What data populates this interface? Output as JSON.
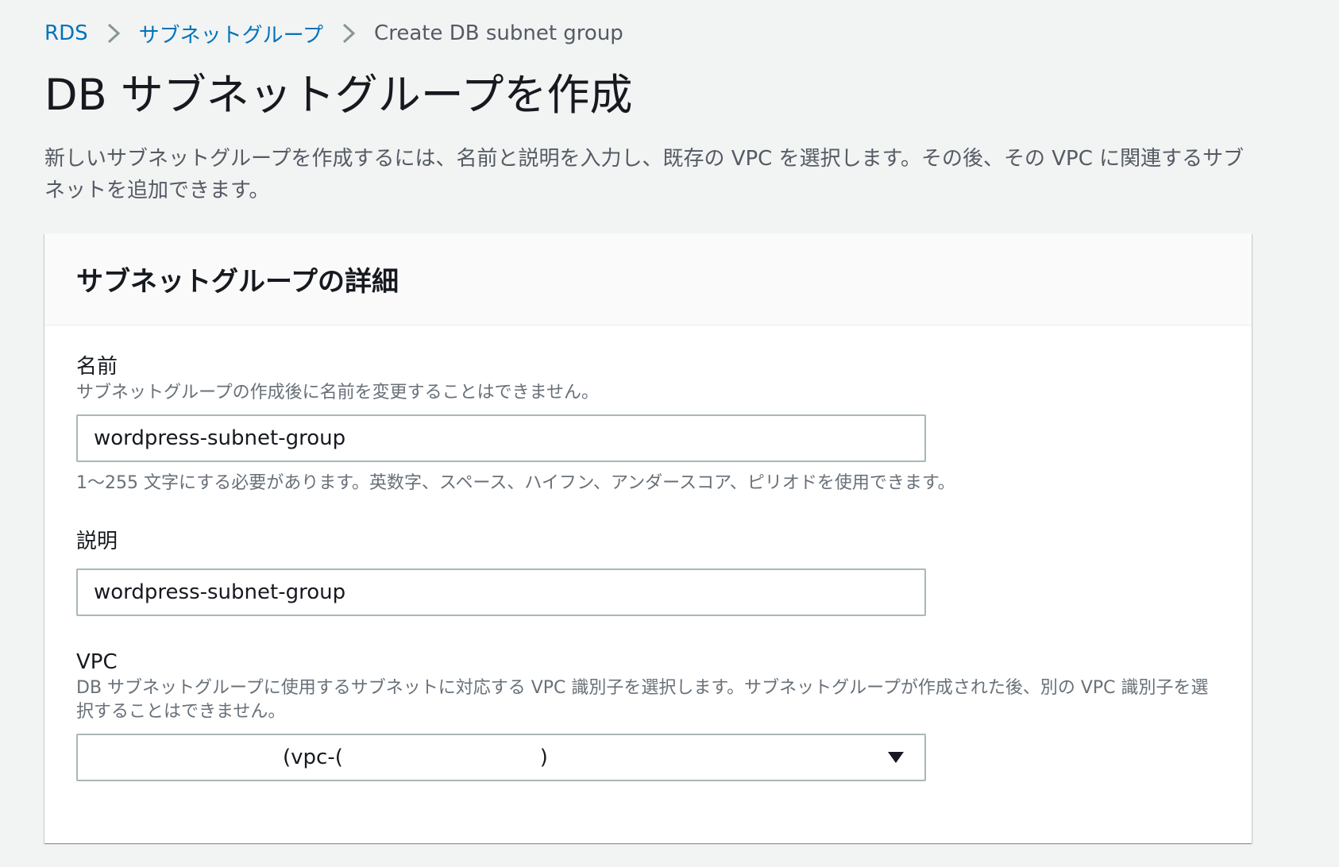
{
  "breadcrumb": {
    "items": [
      {
        "label": "RDS"
      },
      {
        "label": "サブネットグループ"
      },
      {
        "label": "Create DB subnet group"
      }
    ]
  },
  "page": {
    "title": "DB サブネットグループを作成",
    "description": "新しいサブネットグループを作成するには、名前と説明を入力し、既存の VPC を選択します。その後、その VPC に関連するサブネットを追加できます。"
  },
  "panel": {
    "title": "サブネットグループの詳細",
    "name_field": {
      "label": "名前",
      "description": "サブネットグループの作成後に名前を変更することはできません。",
      "value": "wordpress-subnet-group",
      "constraint": "1〜255 文字にする必要があります。英数字、スペース、ハイフン、アンダースコア、ピリオドを使用できます。"
    },
    "description_field": {
      "label": "説明",
      "value": "wordpress-subnet-group"
    },
    "vpc_field": {
      "label": "VPC",
      "description": "DB サブネットグループに使用するサブネットに対応する VPC 識別子を選択します。サブネットグループが作成された後、別の VPC 識別子を選択することはできません。",
      "selected": "(vpc-(                              )"
    }
  },
  "colors": {
    "link": "#0073bb",
    "background": "#f2f3f3",
    "panel_header": "#fafafa",
    "border": "#aab7b8",
    "secondary_text": "#687078"
  },
  "icons": {
    "breadcrumb_separator": "chevron-right-icon",
    "select_caret": "caret-down-icon"
  }
}
